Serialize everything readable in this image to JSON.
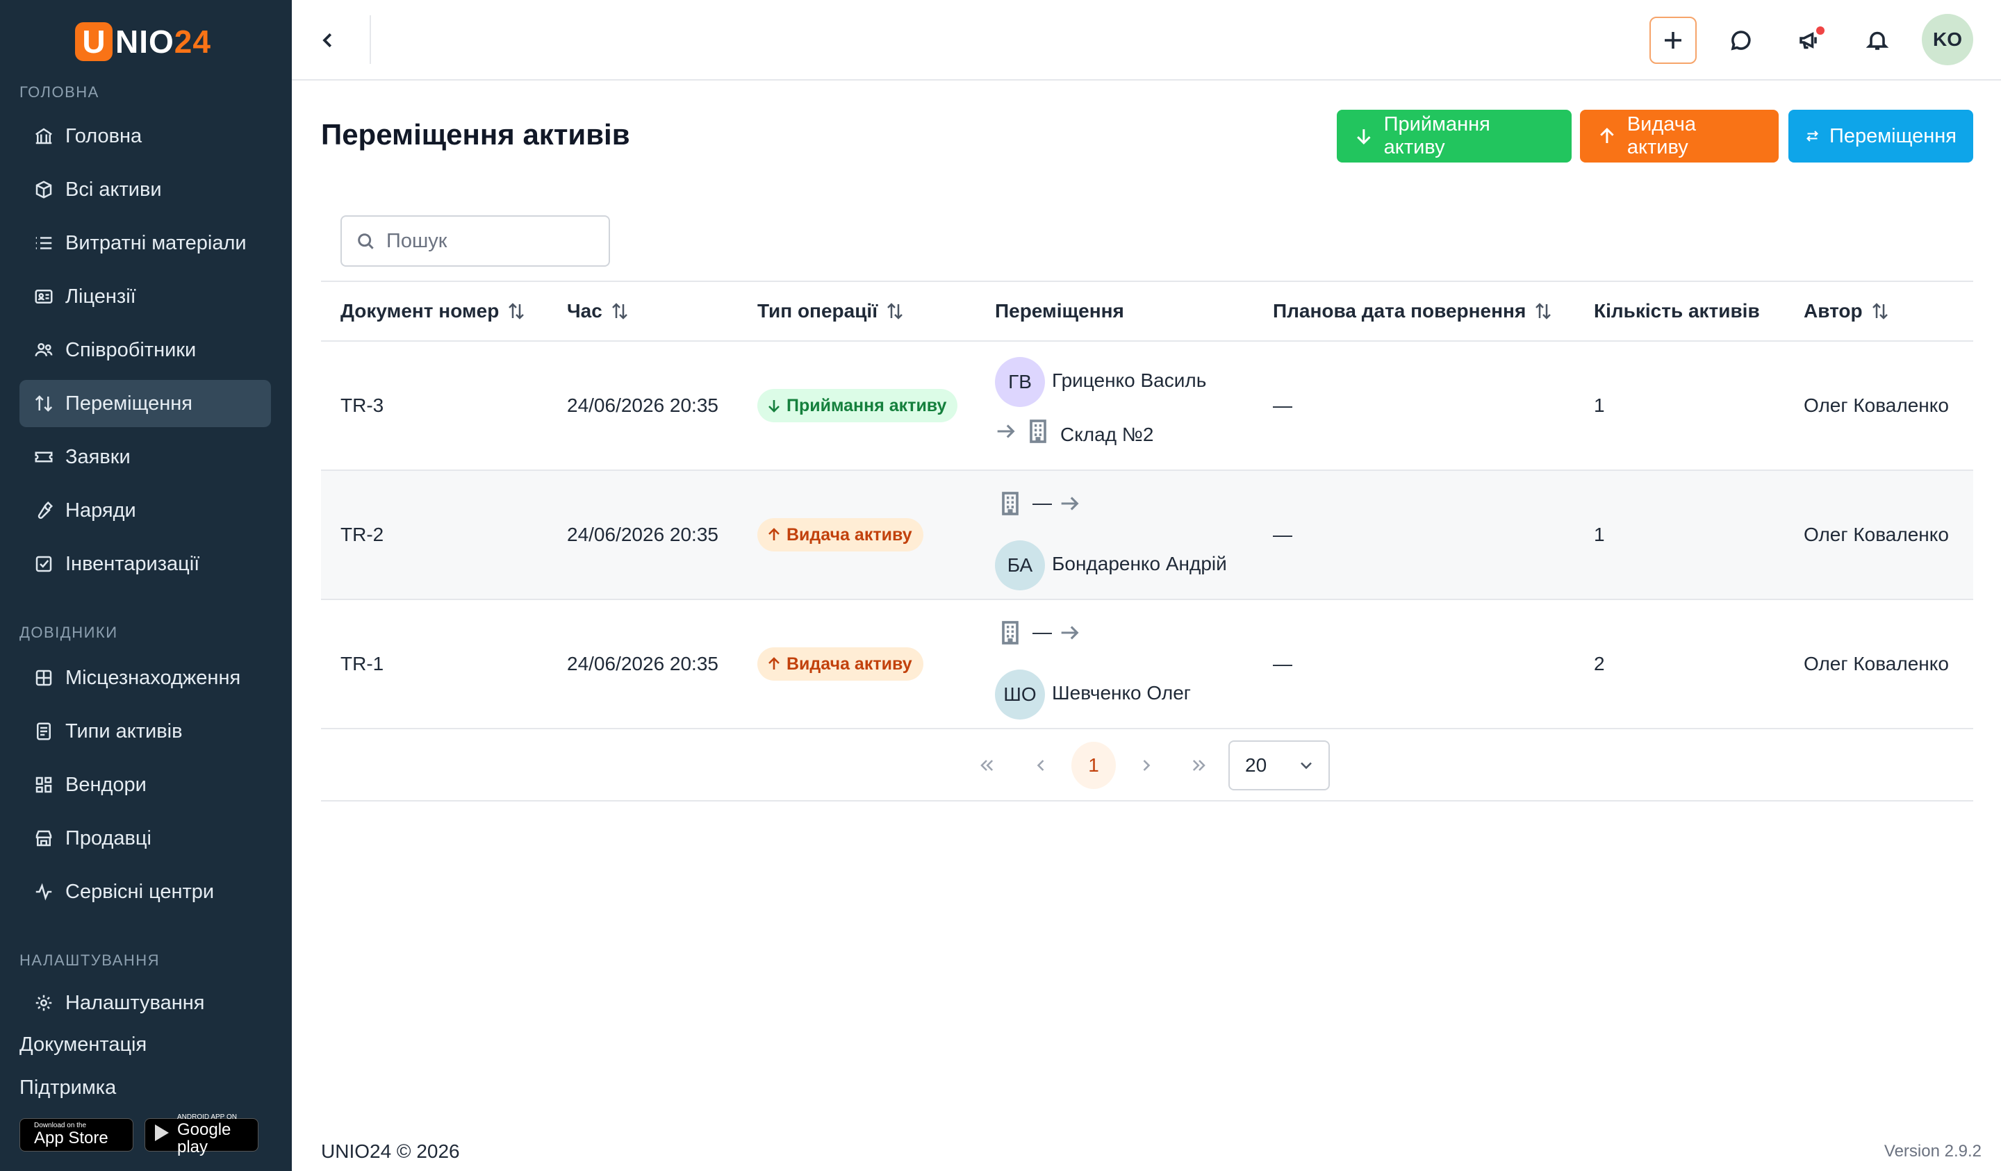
{
  "app": {
    "logo_letter": "U",
    "logo_text": "NIO",
    "logo_num": "24"
  },
  "sidebar": {
    "sections": [
      {
        "title": "ГОЛОВНА"
      },
      {
        "title": "ДОВІДНИКИ"
      },
      {
        "title": "НАЛАШТУВАННЯ"
      }
    ],
    "items": [
      {
        "label": "Головна",
        "icon": "bank-icon"
      },
      {
        "label": "Всі активи",
        "icon": "box-icon"
      },
      {
        "label": "Витратні матеріали",
        "icon": "list-icon"
      },
      {
        "label": "Ліцензії",
        "icon": "license-icon"
      },
      {
        "label": "Співробітники",
        "icon": "users-icon"
      },
      {
        "label": "Переміщення",
        "icon": "transfer-icon",
        "active": true
      },
      {
        "label": "Заявки",
        "icon": "ticket-icon"
      },
      {
        "label": "Наряди",
        "icon": "wrench-icon"
      },
      {
        "label": "Інвентаризації",
        "icon": "checkbox-icon"
      },
      {
        "label": "Місцезнаходження",
        "icon": "grid-icon"
      },
      {
        "label": "Типи активів",
        "icon": "document-icon"
      },
      {
        "label": "Вендори",
        "icon": "vendors-icon"
      },
      {
        "label": "Продавці",
        "icon": "store-icon"
      },
      {
        "label": "Сервісні центри",
        "icon": "activity-icon"
      },
      {
        "label": "Налаштування",
        "icon": "gear-icon"
      }
    ],
    "links": {
      "docs": "Документація",
      "support": "Підтримка"
    },
    "stores": {
      "appstore_small": "Download on the",
      "appstore_big": "App Store",
      "gplay_small": "ANDROID APP ON",
      "gplay_big": "Google play"
    }
  },
  "topbar": {
    "avatar_initials": "KO",
    "icons": [
      "plus-icon",
      "chat-icon",
      "megaphone-icon",
      "bell-icon"
    ]
  },
  "page": {
    "title": "Переміщення активів",
    "actions": {
      "receive": "Приймання активу",
      "issue": "Видача активу",
      "transfer": "Переміщення"
    },
    "search_placeholder": "Пошук"
  },
  "table": {
    "columns": [
      "Документ номер",
      "Час",
      "Тип операції",
      "Переміщення",
      "Планова дата повернення",
      "Кількість активів",
      "Автор"
    ],
    "rows": [
      {
        "doc": "TR-3",
        "time": "24/06/2026 20:35",
        "type": "Приймання активу",
        "type_kind": "receive",
        "from_initials": "ГВ",
        "from_name": "Гриценко Василь",
        "to_name": "Склад №2",
        "return_date": "—",
        "count": "1",
        "author": "Олег Коваленко"
      },
      {
        "doc": "TR-2",
        "time": "24/06/2026 20:35",
        "type": "Видача активу",
        "type_kind": "issue",
        "from_name": "—",
        "to_initials": "БА",
        "to_name": "Бондаренко Андрій",
        "return_date": "—",
        "count": "1",
        "author": "Олег Коваленко"
      },
      {
        "doc": "TR-1",
        "time": "24/06/2026 20:35",
        "type": "Видача активу",
        "type_kind": "issue",
        "from_name": "—",
        "to_initials": "ШО",
        "to_name": "Шевченко Олег",
        "return_date": "—",
        "count": "2",
        "author": "Олег Коваленко"
      }
    ]
  },
  "pagination": {
    "current_page": "1",
    "page_size": "20"
  },
  "footer": {
    "copyright": "UNIO24 © 2026",
    "version": "Version 2.9.2"
  },
  "colors": {
    "sidebar": "#1b2d3c",
    "accent": "#f97316",
    "green": "#22c55e",
    "blue": "#0ea5e9"
  }
}
